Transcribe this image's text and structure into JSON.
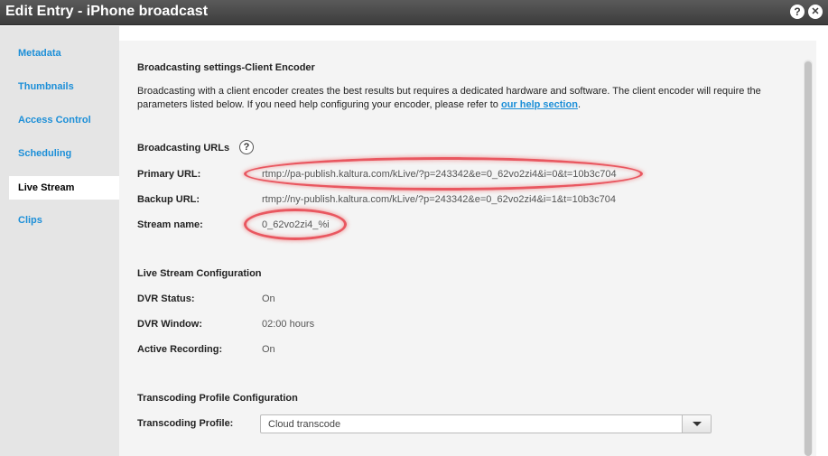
{
  "window": {
    "title": "Edit Entry - iPhone broadcast",
    "help_glyph": "?",
    "close_glyph": "✕"
  },
  "sidebar": {
    "items": [
      {
        "label": "Metadata"
      },
      {
        "label": "Thumbnails"
      },
      {
        "label": "Access Control"
      },
      {
        "label": "Scheduling"
      },
      {
        "label": "Live Stream",
        "active": true
      },
      {
        "label": "Clips"
      }
    ]
  },
  "broadcast": {
    "title": "Broadcasting settings-Client Encoder",
    "desc_text": "Broadcasting with a client encoder creates the best results but requires a dedicated hardware and software. The client encoder will require the parameters listed below. If you need help configuring your encoder, please refer to ",
    "help_link": "our help section",
    "desc_end": "."
  },
  "urls": {
    "title": "Broadcasting URLs",
    "help_glyph": "?",
    "primary_label": "Primary URL:",
    "primary_value": "rtmp://pa-publish.kaltura.com/kLive/?p=243342&e=0_62vo2zi4&i=0&t=10b3c704",
    "backup_label": "Backup URL:",
    "backup_value": "rtmp://ny-publish.kaltura.com/kLive/?p=243342&e=0_62vo2zi4&i=1&t=10b3c704",
    "stream_label": "Stream name:",
    "stream_value": "0_62vo2zi4_%i"
  },
  "live_config": {
    "title": "Live Stream Configuration",
    "dvr_status_label": "DVR Status:",
    "dvr_status_value": "On",
    "dvr_window_label": "DVR Window:",
    "dvr_window_value": "02:00 hours",
    "recording_label": "Active Recording:",
    "recording_value": "On"
  },
  "transcoding": {
    "title": "Transcoding Profile Configuration",
    "profile_label": "Transcoding Profile:",
    "profile_value": "Cloud transcode"
  },
  "colors": {
    "link": "#1c8fd8",
    "highlight": "#e84650",
    "titlebar": "#3c3c3c"
  }
}
